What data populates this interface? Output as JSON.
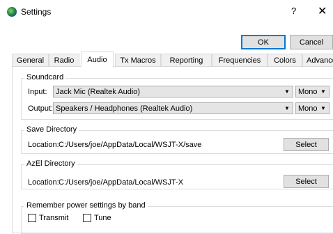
{
  "window": {
    "title": "Settings",
    "help_glyph": "?",
    "close_glyph": "✕"
  },
  "dialog_buttons": {
    "ok_label": "OK",
    "cancel_label": "Cancel"
  },
  "tabs": [
    {
      "label": "General",
      "active": false
    },
    {
      "label": "Radio",
      "active": false
    },
    {
      "label": "Audio",
      "active": true
    },
    {
      "label": "Tx Macros",
      "active": false
    },
    {
      "label": "Reporting",
      "active": false
    },
    {
      "label": "Frequencies",
      "active": false
    },
    {
      "label": "Colors",
      "active": false
    },
    {
      "label": "Advanced",
      "active": false
    }
  ],
  "soundcard": {
    "title": "Soundcard",
    "input": {
      "label": "Input:",
      "device": "Jack Mic (Realtek Audio)",
      "channel": "Mono"
    },
    "output": {
      "label": "Output:",
      "device": "Speakers / Headphones (Realtek Audio)",
      "channel": "Mono"
    }
  },
  "save_directory": {
    "title": "Save Directory",
    "location_label": "Location:",
    "path": "C:/Users/joe/AppData/Local/WSJT-X/save",
    "select_label": "Select"
  },
  "azel_directory": {
    "title": "AzEl Directory",
    "location_label": "Location:",
    "path": "C:/Users/joe/AppData/Local/WSJT-X",
    "select_label": "Select"
  },
  "power_settings": {
    "title": "Remember power settings by band",
    "transmit_label": "Transmit",
    "transmit_checked": false,
    "tune_label": "Tune",
    "tune_checked": false
  },
  "colors": {
    "accent": "#0078d7",
    "button_bg": "#e1e1e1",
    "combo_bg": "#e5e5e5"
  }
}
